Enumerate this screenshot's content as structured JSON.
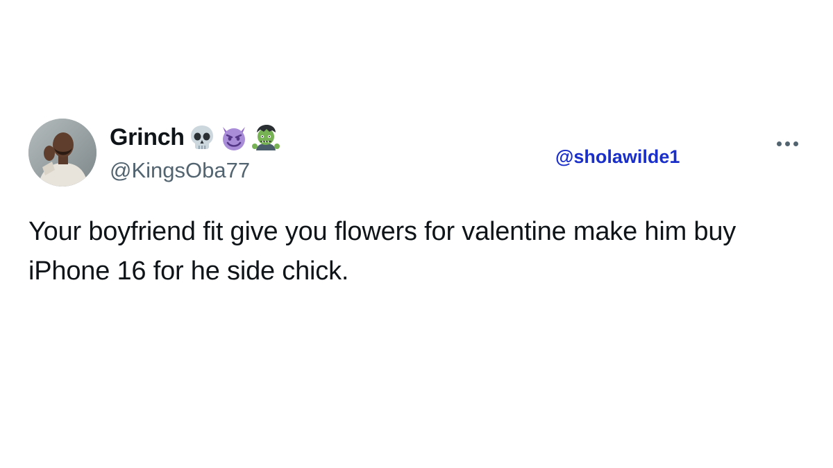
{
  "author": {
    "display_name": "Grinch",
    "handle": "@KingsOba77",
    "name_emojis": [
      "skull-emoji",
      "smiling-devil-emoji",
      "zombie-emoji"
    ]
  },
  "watermark": "@sholawilde1",
  "more_menu_icon": "more-horizontal-icon",
  "tweet": {
    "text": "Your boyfriend fit give you flowers for valentine make him buy iPhone 16 for he side chick."
  },
  "colors": {
    "text_primary": "#0f1419",
    "text_secondary": "#536471",
    "watermark": "#1a2fc9",
    "background": "#ffffff"
  }
}
